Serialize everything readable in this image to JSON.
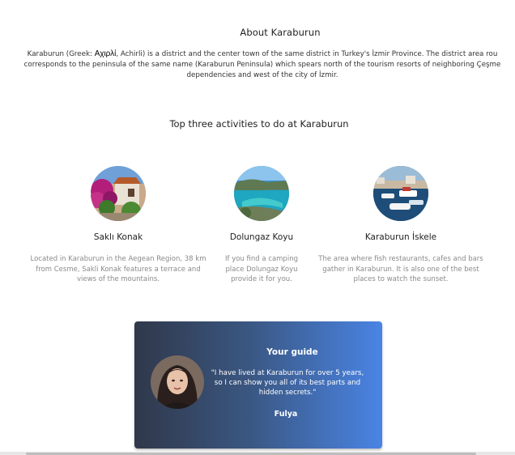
{
  "about": {
    "title": "About Karaburun",
    "line1_a": "Karaburun (Greek: ",
    "line1_greek": "Αχιρλί",
    "line1_b": ", Achirli) is a district and the center town of the same district in Turkey's İzmir Province. The district area rou",
    "line2": "corresponds to the peninsula of the same name (Karaburun Peninsula) which spears north of the tourism resorts of neighboring Çeşme",
    "line3": "dependencies and west of the city of İzmir."
  },
  "activities": {
    "title": "Top three activities to do at Karaburun",
    "items": [
      {
        "name": "Saklı Konak",
        "desc_lines": [
          "Located in Karaburun in the Aegean Region, 38 km",
          "from Cesme, Sakli Konak features a terrace and",
          "views of the mountains."
        ],
        "image": "flower-house-photo"
      },
      {
        "name": "Dolungaz Koyu",
        "desc_lines": [
          "If you find a camping",
          "place Dolungaz Koyu",
          "provide it for you."
        ],
        "image": "bay-photo"
      },
      {
        "name": "Karaburun İskele",
        "desc_lines": [
          "The area where fish restaurants, cafes and bars",
          "gather in Karaburun. It is also one of the best",
          "places to watch the sunset."
        ],
        "image": "harbor-photo"
      }
    ]
  },
  "guide": {
    "heading": "Your guide",
    "quote_lines": [
      "\"I have lived at Karaburun for over 5 years,",
      "so I can show you all of its best parts and",
      "hidden secrets.\""
    ],
    "name": "Fulya",
    "avatar": "guide-portrait",
    "gradient_start": "#30384a",
    "gradient_end": "#4a84e4"
  }
}
